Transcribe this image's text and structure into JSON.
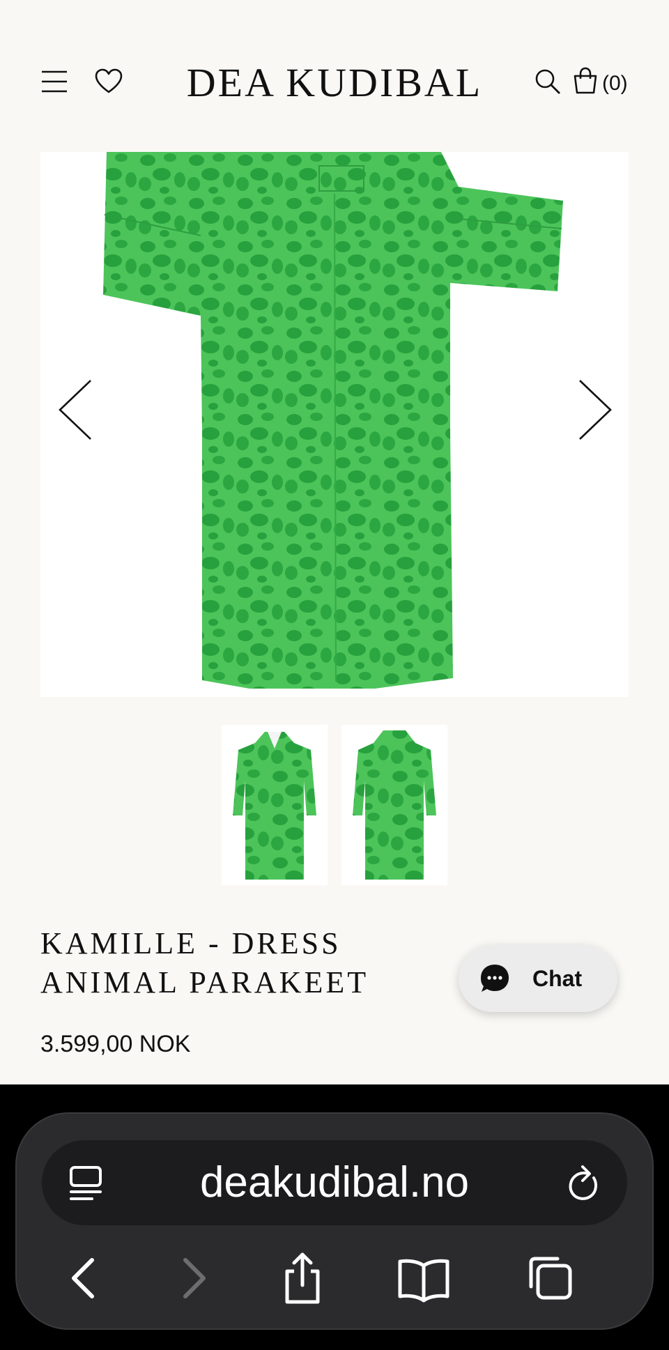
{
  "header": {
    "brand": "DEA KUDIBAL",
    "cart_count": "(0)",
    "icons": [
      "menu-icon",
      "heart-icon",
      "search-icon",
      "bag-icon"
    ]
  },
  "product": {
    "title_line1": "KAMILLE - DRESS",
    "title_line2": "ANIMAL PARAKEET",
    "price": "3.599,00 NOK",
    "main_color": "#3cb54a",
    "pattern_color": "#2a9c3c",
    "thumbnails": [
      "dress-front-thumbnail",
      "dress-back-thumbnail"
    ]
  },
  "chat": {
    "label": "Chat"
  },
  "browser": {
    "url": "deakudibal.no",
    "icons": [
      "tabs-list-icon",
      "reload-icon",
      "back-icon",
      "forward-icon",
      "share-icon",
      "bookmarks-icon",
      "tabs-icon"
    ]
  }
}
